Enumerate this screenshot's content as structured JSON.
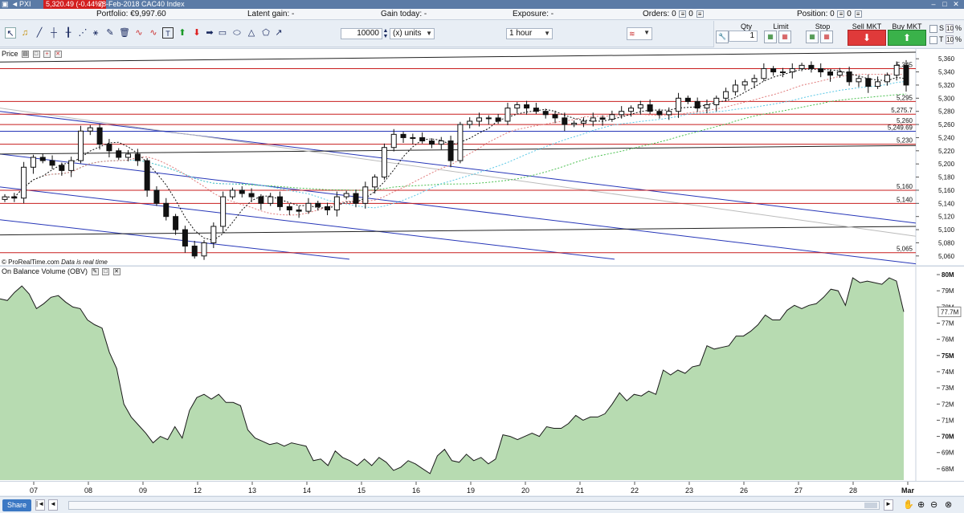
{
  "titlebar": {
    "app_name": "PXI",
    "price_badge": "5,320.49 (-0.44%)",
    "instrument": "28-Feb-2018 CAC40 Index"
  },
  "infobar": {
    "portfolio": "Portfolio: €9,997.60",
    "latent_gain": "Latent gain: -",
    "gain_today": "Gain today: -",
    "exposure": "Exposure: -",
    "orders": "Orders: 0",
    "orders_count": "0",
    "position": "Position: 0",
    "position_count": "0"
  },
  "toolbar": {
    "quantity_value": "10000",
    "units_label": "(x) units",
    "timeframe": "1 hour"
  },
  "order_panel": {
    "qty_label": "Qty",
    "qty_value": "1",
    "limit_label": "Limit",
    "stop_label": "Stop",
    "sell_label": "Sell MKT",
    "buy_label": "Buy MKT",
    "s_label": "S",
    "t_label": "T",
    "pct_s": "%",
    "pct_t": "%",
    "ten_s": "10",
    "ten_t": "10"
  },
  "price_pane": {
    "title": "Price",
    "credit_brand": "© ProRealTime.com",
    "credit_note": "Data is real time",
    "level_labels": [
      "5,345",
      "5,295",
      "5,275.7",
      "5,260",
      "5,249.69",
      "5,230",
      "5,160",
      "5,140",
      "5,065"
    ],
    "axis_ticks": [
      "5,360",
      "5,340",
      "5,320",
      "5,300",
      "5,280",
      "5,260",
      "5,240",
      "5,220",
      "5,200",
      "5,180",
      "5,160",
      "5,140",
      "5,120",
      "5,100",
      "5,080",
      "5,060"
    ]
  },
  "obv_pane": {
    "title": "On Balance Volume (OBV)",
    "axis_ticks": [
      "80M",
      "79M",
      "78M",
      "77M",
      "76M",
      "75M",
      "74M",
      "73M",
      "72M",
      "71M",
      "70M",
      "69M",
      "68M"
    ],
    "last_value": "77.7M"
  },
  "xaxis": {
    "labels": [
      "07",
      "08",
      "09",
      "12",
      "13",
      "14",
      "15",
      "16",
      "19",
      "20",
      "21",
      "22",
      "23",
      "26",
      "27",
      "28",
      "Mar"
    ]
  },
  "statusbar": {
    "share_label": "Share"
  },
  "chart_data": {
    "type": "candlestick",
    "price_ylim": [
      5050,
      5370
    ],
    "horizontal_levels": [
      5345,
      5295,
      5275.7,
      5260,
      5249.69,
      5230,
      5160,
      5140,
      5065
    ],
    "close_series": [
      5150,
      5148,
      5195,
      5210,
      5205,
      5198,
      5190,
      5205,
      5250,
      5255,
      5230,
      5220,
      5210,
      5215,
      5205,
      5160,
      5140,
      5120,
      5100,
      5075,
      5060,
      5080,
      5105,
      5150,
      5160,
      5155,
      5150,
      5140,
      5150,
      5135,
      5130,
      5128,
      5140,
      5135,
      5130,
      5150,
      5155,
      5140,
      5165,
      5180,
      5225,
      5245,
      5240,
      5240,
      5235,
      5230,
      5235,
      5205,
      5260,
      5265,
      5270,
      5270,
      5265,
      5285,
      5290,
      5285,
      5280,
      5275,
      5270,
      5260,
      5262,
      5265,
      5270,
      5268,
      5275,
      5280,
      5285,
      5290,
      5280,
      5275,
      5280,
      5300,
      5295,
      5285,
      5290,
      5300,
      5310,
      5320,
      5325,
      5330,
      5345,
      5340,
      5340,
      5345,
      5350,
      5345,
      5340,
      5335,
      5340,
      5325,
      5330,
      5318,
      5325,
      5335,
      5350,
      5320
    ],
    "obv_ylim": [
      67.3,
      80.3
    ],
    "obv_series": [
      78.5,
      78.4,
      78.9,
      79.3,
      78.8,
      77.9,
      78.2,
      78.6,
      78.7,
      78.3,
      78.0,
      77.9,
      77.2,
      76.9,
      76.7,
      75.2,
      74.2,
      72.0,
      71.2,
      70.7,
      70.2,
      69.6,
      70.0,
      69.8,
      70.6,
      69.9,
      71.6,
      72.4,
      72.6,
      72.3,
      72.6,
      72.1,
      72.1,
      71.9,
      70.4,
      69.9,
      69.7,
      69.5,
      69.6,
      69.4,
      69.6,
      69.5,
      69.4,
      68.5,
      68.6,
      68.2,
      69.1,
      68.7,
      68.5,
      68.2,
      68.6,
      68.2,
      68.7,
      68.4,
      67.9,
      68.1,
      68.5,
      68.3,
      68.0,
      67.7,
      68.8,
      69.2,
      68.5,
      68.4,
      68.9,
      68.5,
      68.7,
      68.3,
      68.6,
      70.1,
      70.0,
      69.8,
      70.0,
      70.2,
      70.0,
      70.6,
      70.5,
      70.5,
      70.8,
      71.3,
      71.0,
      71.2,
      71.2,
      71.4,
      72.0,
      72.7,
      72.2,
      72.6,
      72.5,
      72.8,
      72.6,
      74.1,
      73.8,
      74.1,
      73.9,
      74.3,
      74.4,
      75.6,
      75.4,
      75.5,
      75.6,
      76.2,
      76.2,
      76.5,
      76.9,
      77.5,
      77.2,
      77.2,
      77.8,
      78.1,
      77.9,
      78.1,
      78.2,
      78.6,
      79.1,
      79.0,
      78.1,
      79.8,
      79.5,
      79.6,
      79.5,
      79.4,
      79.8,
      79.6,
      77.7
    ]
  }
}
